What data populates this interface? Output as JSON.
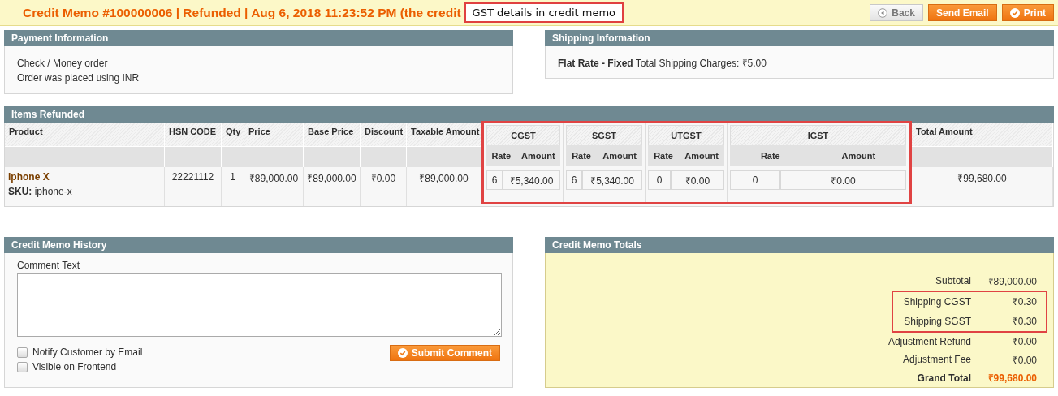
{
  "header": {
    "title": "Credit Memo #100000006 | Refunded | Aug 6, 2018 11:23:52 PM (the credit",
    "annotation": "GST details in credit memo",
    "buttons": [
      {
        "label": "Back",
        "kind": "back"
      },
      {
        "label": "Send Email",
        "kind": "primary"
      },
      {
        "label": "Print",
        "kind": "print"
      }
    ]
  },
  "payment": {
    "title": "Payment Information",
    "lines": [
      "Check / Money order",
      "Order was placed using INR"
    ]
  },
  "shipping": {
    "title": "Shipping Information",
    "text": "**Flat Rate - Fixed** Total Shipping Charges: ₹5.00"
  },
  "items": {
    "title": "Items Refunded",
    "columns": [
      "Product",
      "HSN CODE",
      "Qty",
      "Price",
      "Base Price",
      "Discount",
      "Taxable Amount"
    ],
    "total_column": "Total Amount",
    "taxes_highlighted": true,
    "tax_groups": [
      {
        "name": "CGST",
        "rate_label": "Rate",
        "amount_label": "Amount"
      },
      {
        "name": "SGST",
        "rate_label": "Rate",
        "amount_label": "Amount"
      },
      {
        "name": "UTGST",
        "rate_label": "Rate",
        "amount_label": "Amount"
      },
      {
        "name": "IGST",
        "rate_label": "Rate",
        "amount_label": "Amount"
      }
    ],
    "rows": [
      {
        "product": "Iphone X",
        "sku": "**SKU:** iphone-x",
        "hsn": "22221112",
        "qty": "1",
        "price": "₹89,000.00",
        "base_price": "₹89,000.00",
        "discount": "₹0.00",
        "taxable": "₹89,000.00",
        "taxes": [
          {
            "rate": "6",
            "amount": "₹5,340.00"
          },
          {
            "rate": "6",
            "amount": "₹5,340.00"
          },
          {
            "rate": "0",
            "amount": "₹0.00"
          },
          {
            "rate": "0",
            "amount": "₹0.00"
          }
        ],
        "total": "₹99,680.00"
      }
    ]
  },
  "history": {
    "title": "Credit Memo History",
    "comment_label": "Comment Text",
    "options": [
      {
        "label": "Notify Customer by Email",
        "checked": false
      },
      {
        "label": "Visible on Frontend",
        "checked": false
      }
    ],
    "submit": "Submit Comment"
  },
  "totals": {
    "title": "Credit Memo Totals",
    "rows": [
      {
        "label": "Subtotal",
        "value": "₹89,000.00",
        "kind": "normal",
        "highlighted": false
      },
      {
        "label": "Shipping CGST",
        "value": "₹0.30",
        "kind": "normal",
        "highlighted": true
      },
      {
        "label": "Shipping SGST",
        "value": "₹0.30",
        "kind": "normal",
        "highlighted": true
      },
      {
        "label": "Adjustment Refund",
        "value": "₹0.00",
        "kind": "normal",
        "highlighted": false
      },
      {
        "label": "Adjustment Fee",
        "value": "₹0.00",
        "kind": "normal",
        "highlighted": false
      },
      {
        "label": "Grand Total",
        "value": "₹99,680.00",
        "kind": "grand",
        "highlighted": false
      }
    ]
  }
}
